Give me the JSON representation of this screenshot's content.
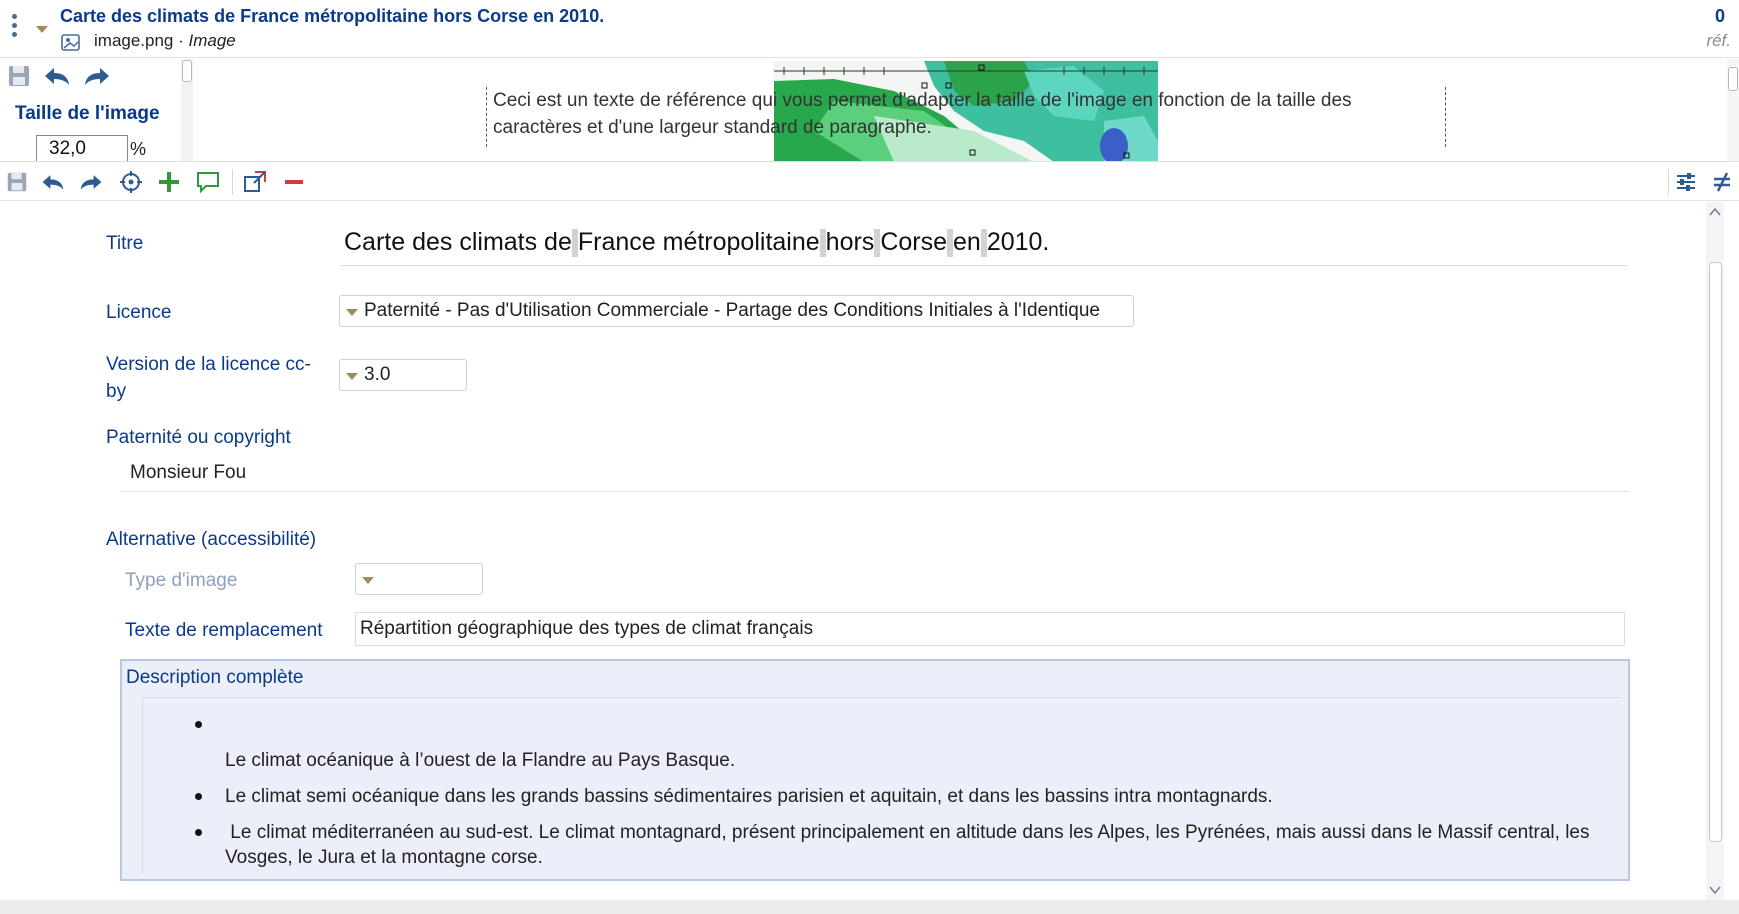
{
  "header": {
    "title": "Carte des climats de France métropolitaine hors Corse en 2010.",
    "filename": "image.png",
    "separator": " · ",
    "type": "Image",
    "ref_count": "0",
    "ref_label": "réf."
  },
  "preview": {
    "size_label": "Taille de l'image",
    "size_value": "32,0",
    "size_unit": "%",
    "reference_text": "Ceci est un texte de référence qui vous permet d'adapter la taille de l'image en fonction de la taille des caractères et d'une largeur standard de paragraphe."
  },
  "form": {
    "title_label": "Titre",
    "title_words": [
      "Carte des climats de",
      "France métropolitaine",
      "hors",
      "Corse",
      "en",
      "2010."
    ],
    "licence_label": "Licence",
    "licence_value": "Paternité - Pas d'Utilisation Commerciale - Partage des Conditions Initiales à l'Identique",
    "licence_version_label": "Version de la licence cc-by",
    "licence_version_value": "3.0",
    "copyright_label": "Paternité ou copyright",
    "copyright_value": "Monsieur Fou",
    "accessibility_label": "Alternative (accessibilité)",
    "image_type_label": "Type d'image",
    "image_type_value": "",
    "alt_text_label": "Texte de remplacement",
    "alt_text_value": "Répartition géographique des types de climat français",
    "description_label": "Description complète",
    "description_items": [
      "",
      "Le climat océanique à l’ouest de la Flandre au Pays Basque.",
      "Le climat semi océanique dans les grands bassins sédimentaires parisien et aquitain, et dans les bassins intra montagnards.",
      " Le climat méditerranéen au sud-est. Le climat montagnard, présent principalement en altitude dans les Alpes, les Pyrénées, mais aussi dans le Massif central, les Vosges, le Jura et la montagne corse."
    ]
  },
  "colors": {
    "accent": "#0b3a8a",
    "muted_label": "#8ea0bf",
    "caret": "#a08b60",
    "description_bg": "#eceffa",
    "green_action": "#2e9a3a",
    "red_action": "#d33a3a"
  },
  "icons": {
    "toolbar": [
      "save-icon",
      "undo-icon",
      "redo-icon",
      "target-icon",
      "add-icon",
      "comment-icon",
      "external-link-icon",
      "remove-icon"
    ],
    "side": [
      "sliders-icon",
      "not-equal-icon"
    ]
  }
}
